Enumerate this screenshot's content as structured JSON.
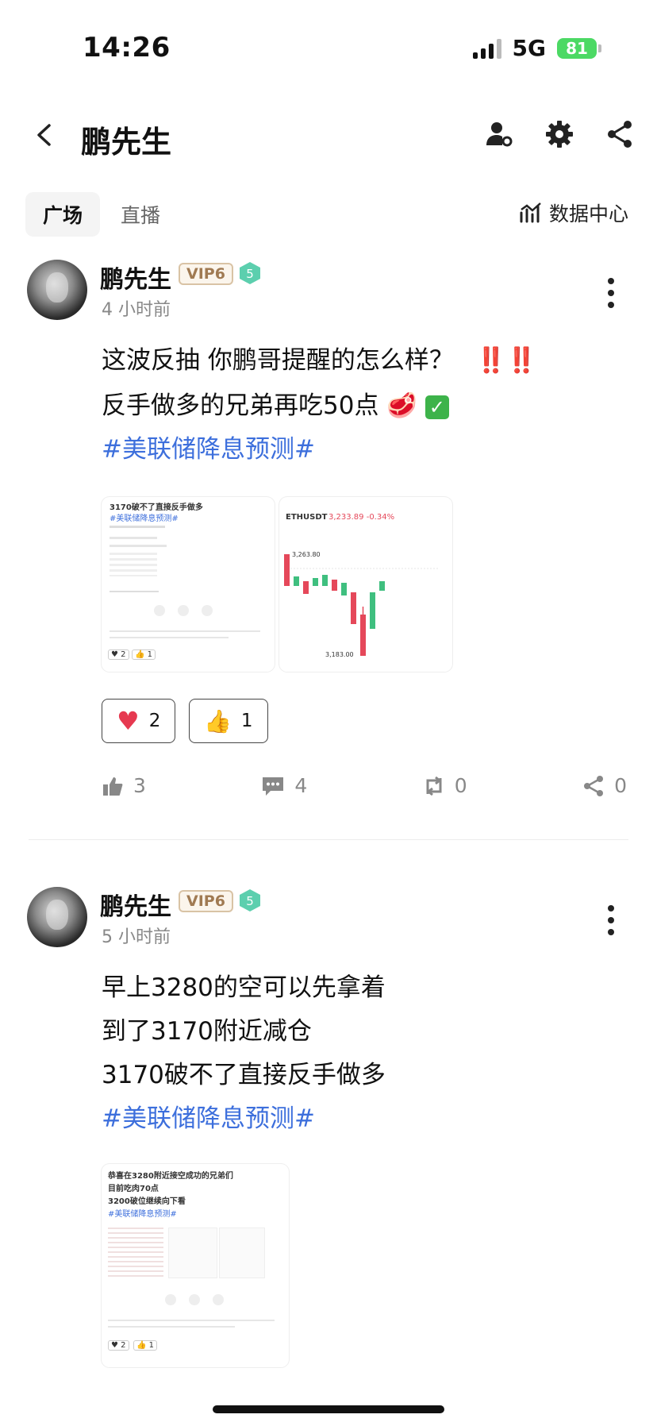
{
  "status_bar": {
    "time": "14:26",
    "network": "5G",
    "battery": "81"
  },
  "nav": {
    "title": "鹏先生"
  },
  "tabs": [
    {
      "label": "广场"
    },
    {
      "label": "直播"
    }
  ],
  "data_center": {
    "label": "数据中心"
  },
  "posts": [
    {
      "author": "鹏先生",
      "vip": "VIP6",
      "level": "5",
      "time": "4 小时前",
      "lines": [
        "这波反抽 你鹏哥提醒的怎么样？",
        "反手做多的兄弟再吃50点"
      ],
      "exclaim": "‼️‼️",
      "hashtag": "#美联储降息预测#",
      "thumbnails": [
        {
          "title": "3170破不了直接反手做多",
          "tag": "#美联储降息预测#",
          "counts": [
            "2",
            "1"
          ]
        },
        {
          "symbol": "ETHUSDT",
          "price": "3,233.89 -0.34%",
          "high": "3,263.80",
          "low": "3,183.00"
        }
      ],
      "reactions": [
        {
          "emoji": "heart",
          "count": "2"
        },
        {
          "emoji": "thumbs-up",
          "count": "1"
        }
      ],
      "actions": {
        "likes": "3",
        "comments": "4",
        "reposts": "0",
        "shares": "0"
      }
    },
    {
      "author": "鹏先生",
      "vip": "VIP6",
      "level": "5",
      "time": "5 小时前",
      "lines": [
        "早上3280的空可以先拿着",
        "到了3170附近减仓",
        "3170破不了直接反手做多"
      ],
      "hashtag": "#美联储降息预测#",
      "thumbnails": [
        {
          "title": "恭喜在3280附近接空成功的兄弟们",
          "line2": "目前吃肉70点",
          "line3": "3200破位继续向下看",
          "tag": "#美联储降息预测#",
          "counts": [
            "2",
            "1"
          ]
        }
      ]
    }
  ],
  "colors": {
    "accent": "#3d6fdc",
    "vip_text": "#a07a52",
    "level_badge": "#5ccfae",
    "candle_up": "#3fbf7f",
    "candle_down": "#e5485a"
  }
}
